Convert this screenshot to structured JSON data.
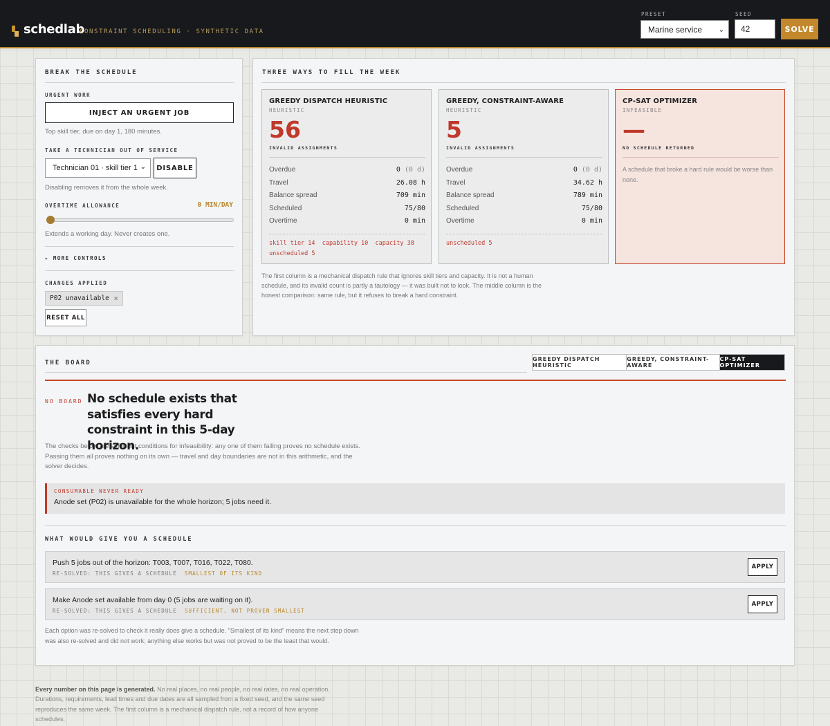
{
  "header": {
    "brand": "schedlab",
    "tagline": "CONSTRAINT SCHEDULING · SYNTHETIC DATA",
    "preset_label": "PRESET",
    "preset_value": "Marine service",
    "seed_label": "SEED",
    "seed_value": "42",
    "solve_label": "SOLVE"
  },
  "break_panel": {
    "title": "BREAK THE SCHEDULE",
    "urgent_label": "URGENT WORK",
    "inject_label": "INJECT AN URGENT JOB",
    "inject_hint": "Top skill tier, due on day 1, 180 minutes.",
    "tech_label": "TAKE A TECHNICIAN OUT OF SERVICE",
    "tech_select": "Technician 01 · skill tier 1",
    "disable_label": "DISABLE",
    "tech_hint": "Disabling removes it from the whole week.",
    "overtime_label": "OVERTIME ALLOWANCE",
    "overtime_value": "0 MIN/DAY",
    "overtime_fraction": 0,
    "overtime_hint": "Extends a working day. Never creates one.",
    "more_controls": "▸ MORE CONTROLS",
    "changes_label": "CHANGES APPLIED",
    "change_chip": "P02 unavailable",
    "chip_close": "×",
    "reset_label": "RESET ALL"
  },
  "compare_panel": {
    "title": "THREE WAYS TO FILL THE WEEK",
    "columns": [
      {
        "title": "GREEDY DISPATCH HEURISTIC",
        "sub": "HEURISTIC",
        "big": "56",
        "big_label": "INVALID ASSIGNMENTS",
        "metrics": [
          {
            "label": "Overdue",
            "value": "0",
            "extra": "(0 d)"
          },
          {
            "label": "Travel",
            "value": "26.08 h",
            "extra": ""
          },
          {
            "label": "Balance spread",
            "value": "709 min",
            "extra": ""
          },
          {
            "label": "Scheduled",
            "value": "75/80",
            "extra": ""
          },
          {
            "label": "Overtime",
            "value": "0 min",
            "extra": ""
          }
        ],
        "flags_line1": "skill tier 14  capability 10  capacity 38",
        "flags_line2": "unscheduled 5"
      },
      {
        "title": "GREEDY, CONSTRAINT-AWARE",
        "sub": "HEURISTIC",
        "big": "5",
        "big_label": "INVALID ASSIGNMENTS",
        "metrics": [
          {
            "label": "Overdue",
            "value": "0",
            "extra": "(0 d)"
          },
          {
            "label": "Travel",
            "value": "34.62 h",
            "extra": ""
          },
          {
            "label": "Balance spread",
            "value": "789 min",
            "extra": ""
          },
          {
            "label": "Scheduled",
            "value": "75/80",
            "extra": ""
          },
          {
            "label": "Overtime",
            "value": "0 min",
            "extra": ""
          }
        ],
        "flags_line1": "unscheduled 5"
      },
      {
        "title": "CP-SAT OPTIMIZER",
        "sub": "INFEASIBLE",
        "big": "—",
        "big_label": "NO SCHEDULE RETURNED",
        "note": "A schedule that broke a hard rule would be worse than none."
      }
    ],
    "footnote": "The first column is a mechanical dispatch rule that ignores skill tiers and capacity. It is not a human schedule, and its invalid count is partly a tautology — it was built not to look. The middle column is the honest comparison: same rule, but it refuses to break a hard constraint."
  },
  "board": {
    "title": "THE BOARD",
    "tabs": [
      "GREEDY DISPATCH HEURISTIC",
      "GREEDY, CONSTRAINT-AWARE",
      "CP-SAT OPTIMIZER"
    ],
    "no_board_tag": "NO BOARD",
    "headline": "No schedule exists that satisfies every hard constraint in this 5-day horizon.",
    "explain": "The checks below are sufficient conditions for infeasibility: any one of them failing proves no schedule exists. Passing them all proves nothing on its own — travel and day boundaries are not in this arithmetic, and the solver decides.",
    "callout_tag": "CONSUMABLE NEVER READY",
    "callout_text": "Anode set (P02) is unavailable for the whole horizon; 5 jobs need it.",
    "fix_title": "WHAT WOULD GIVE YOU A SCHEDULE",
    "options": [
      {
        "text": "Push 5 jobs out of the horizon: T003, T007, T016, T022, T080.",
        "mono": "RE-SOLVED: THIS GIVES A SCHEDULE",
        "accent": "SMALLEST OF ITS KIND",
        "apply": "APPLY"
      },
      {
        "text": "Make Anode set available from day 0 (5 jobs are waiting on it).",
        "mono": "RE-SOLVED: THIS GIVES A SCHEDULE",
        "accent": "SUFFICIENT, NOT PROVEN SMALLEST",
        "apply": "APPLY"
      }
    ],
    "options_note": "Each option was re-solved to check it really does give a schedule. \"Smallest of its kind\" means the next step down was also re-solved and did not work; anything else works but was not proved to be the least that would."
  },
  "footer": {
    "bold": "Every number on this page is generated.",
    "text": " No real places, no real people, no real rates, no real operation. Durations, requirements, lead times and due dates are all sampled from a fixed seed, and the same seed reproduces the same week. The first column is a mechanical dispatch rule, not a record of how anyone schedules."
  },
  "colors": {
    "accent": "#c2882b",
    "danger": "#c0392b",
    "dark": "#17191c"
  }
}
